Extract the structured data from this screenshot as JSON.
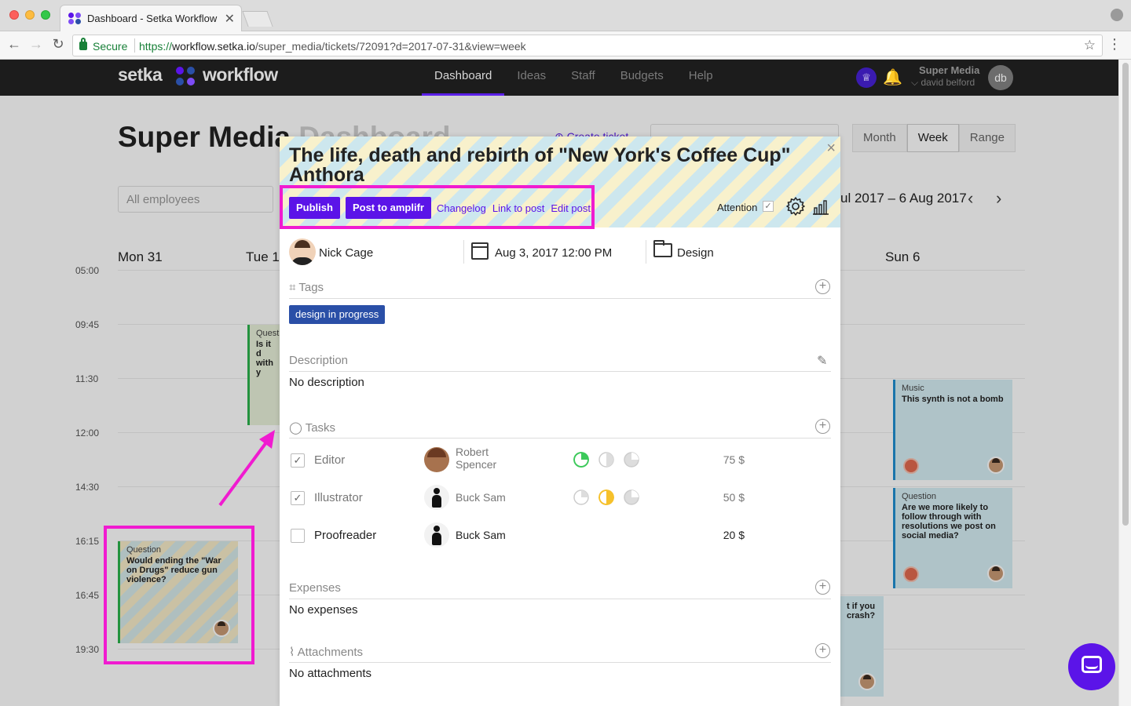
{
  "browser": {
    "tab_title": "Dashboard - Setka Workflow",
    "tab_close": "✕",
    "secure_label": "Secure",
    "url_scheme": "https://",
    "url_host": "workflow.setka.io",
    "url_path": "/super_media/tickets/72091?d=2017-07-31&view=week"
  },
  "header": {
    "logo_left": "setka",
    "logo_right": "workflow",
    "nav": [
      "Dashboard",
      "Ideas",
      "Staff",
      "Budgets",
      "Help"
    ],
    "active_nav": "Dashboard",
    "org_name": "Super Media",
    "user_name": "david belford",
    "avatar_initials": "db"
  },
  "dashboard": {
    "title_main": "Super Media",
    "title_faded": " Dashboard",
    "create_ticket": "Create ticket",
    "view_options": [
      "Month",
      "Week",
      "Range"
    ],
    "active_view": "Week",
    "employee_filter": "All employees",
    "date_range": "ul 2017 – 6 Aug 2017",
    "days": {
      "mon": "Mon 31",
      "tue": "Tue 1",
      "sun": "Sun 6"
    },
    "times": [
      "05:00",
      "09:45",
      "11:30",
      "12:00",
      "14:30",
      "16:15",
      "16:45",
      "19:30"
    ],
    "cards": {
      "tue": {
        "category": "Quest",
        "text": "Is it d with y"
      },
      "mon": {
        "category": "Question",
        "text": "Would ending the \"War on Drugs\" reduce gun violence?"
      },
      "sun1": {
        "category": "Music",
        "text": "This synth is not a bomb"
      },
      "sun2": {
        "category": "Question",
        "text": "Are we more likely to follow through with resolutions we post on social media?"
      },
      "sat": {
        "text": "t if you crash?"
      }
    }
  },
  "ticket": {
    "title": "The life, death and rebirth of \"New York's Coffee Cup\" Anthora",
    "close": "×",
    "buttons": {
      "publish": "Publish",
      "post_to": "Post to amplifr"
    },
    "links": {
      "changelog": "Changelog",
      "link_to_post": "Link to post",
      "edit_post": "Edit post"
    },
    "attention_label": "Attention",
    "assignee": "Nick Cage",
    "due_date": "Aug 3, 2017 12:00 PM",
    "category": "Design",
    "tags_title": "Tags",
    "tags": [
      "design in progress"
    ],
    "description_title": "Description",
    "description": "No description",
    "tasks_title": "Tasks",
    "tasks": [
      {
        "role": "Editor",
        "checked": true,
        "person_line1": "Robert",
        "person_line2": "Spencer",
        "price": "75 $"
      },
      {
        "role": "Illustrator",
        "checked": true,
        "person": "Buck Sam",
        "price": "50 $"
      },
      {
        "role": "Proofreader",
        "checked": false,
        "person": "Buck Sam",
        "price": "20 $"
      }
    ],
    "expenses_title": "Expenses",
    "expenses": "No expenses",
    "attachments_title": "Attachments",
    "attachments": "No attachments"
  },
  "colors": {
    "accent": "#5b14e8",
    "tag": "#2a4fa7",
    "annotation": "#f01bd0",
    "pie_green": "#3cc95a",
    "pie_yellow": "#f6c12b"
  },
  "icons": {
    "add": "+",
    "check": "✓",
    "bell": "🔔",
    "trophy": "♕",
    "pencil": "✎",
    "star": "☆"
  }
}
